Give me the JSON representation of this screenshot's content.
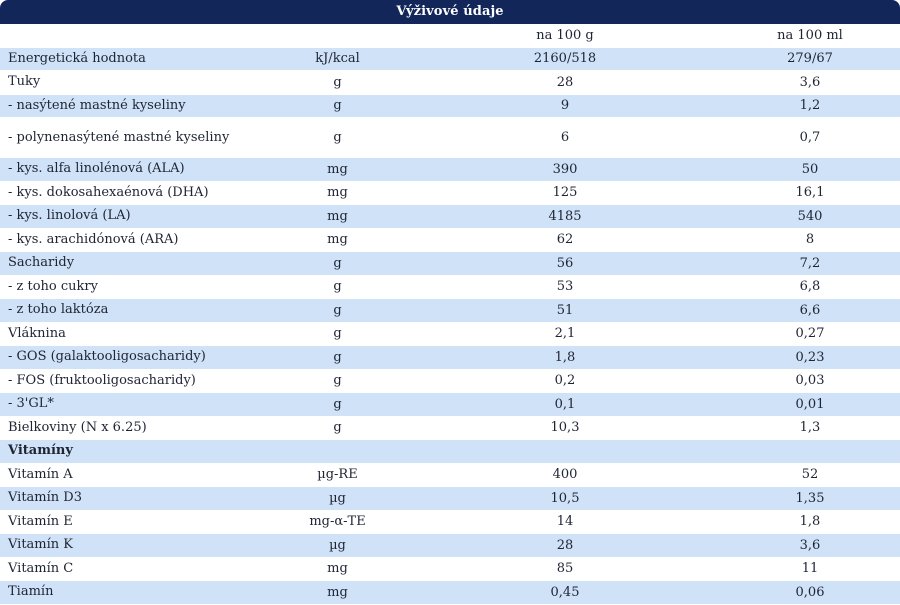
{
  "title": "Výživové údaje",
  "header": {
    "unit": "",
    "col1": "na 100 g",
    "col2": "na 100 ml"
  },
  "rows": [
    {
      "name": "Energetická hodnota",
      "unit": "kJ/kcal",
      "g": "2160/518",
      "ml": "279/67"
    },
    {
      "name": "Tuky",
      "unit": "g",
      "g": "28",
      "ml": "3,6"
    },
    {
      "name": "- nasýtené mastné kyseliny",
      "unit": "g",
      "g": "9",
      "ml": "1,2"
    },
    {
      "name": "- polynenasýtené mastné kyseliny",
      "unit": "g",
      "g": "6",
      "ml": "0,7"
    },
    {
      "name": "- kys. alfa linolénová (ALA)",
      "unit": "mg",
      "g": "390",
      "ml": "50"
    },
    {
      "name": "- kys. dokosahexaénová (DHA)",
      "unit": "mg",
      "g": "125",
      "ml": "16,1"
    },
    {
      "name": "- kys. linolová (LA)",
      "unit": "mg",
      "g": "4185",
      "ml": "540"
    },
    {
      "name": "- kys. arachidónová (ARA)",
      "unit": "mg",
      "g": "62",
      "ml": "8"
    },
    {
      "name": "Sacharidy",
      "unit": "g",
      "g": "56",
      "ml": "7,2"
    },
    {
      "name": "- z toho cukry",
      "unit": "g",
      "g": "53",
      "ml": "6,8"
    },
    {
      "name": "- z toho laktóza",
      "unit": "g",
      "g": "51",
      "ml": "6,6"
    },
    {
      "name": "Vláknina",
      "unit": "g",
      "g": "2,1",
      "ml": "0,27"
    },
    {
      "name": "- GOS (galaktooligosacharidy)",
      "unit": "g",
      "g": "1,8",
      "ml": "0,23"
    },
    {
      "name": "- FOS (fruktooligosacharidy)",
      "unit": "g",
      "g": "0,2",
      "ml": "0,03"
    },
    {
      "name": "- 3'GL*",
      "unit": "g",
      "g": "0,1",
      "ml": "0,01"
    },
    {
      "name": "Bielkoviny (N x 6.25)",
      "unit": "g",
      "g": "10,3",
      "ml": "1,3"
    },
    {
      "name": "Vitamíny"
    },
    {
      "name": "Vitamín A",
      "unit": "µg-RE",
      "g": "400",
      "ml": "52"
    },
    {
      "name": "Vitamín D3",
      "unit": "µg",
      "g": "10,5",
      "ml": "1,35"
    },
    {
      "name": "Vitamín E",
      "unit": "mg-α-TE",
      "g": "14",
      "ml": "1,8"
    },
    {
      "name": "Vitamín K",
      "unit": "µg",
      "g": "28",
      "ml": "3,6"
    },
    {
      "name": "Vitamín C",
      "unit": "mg",
      "g": "85",
      "ml": "11"
    },
    {
      "name": "Tiamín",
      "unit": "mg",
      "g": "0,45",
      "ml": "0,06"
    }
  ]
}
